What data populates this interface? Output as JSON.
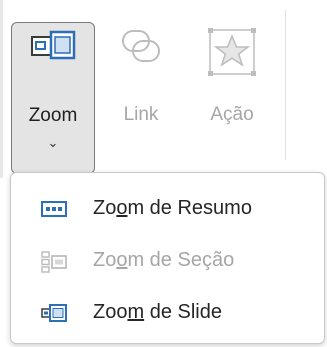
{
  "ribbon": {
    "zoom": {
      "label": "Zoom",
      "chevron": "⌄",
      "icon": "zoom-slides-icon"
    },
    "link": {
      "label": "Link",
      "icon": "link-icon"
    },
    "acao": {
      "label": "Ação",
      "icon": "action-star-icon"
    }
  },
  "menu": {
    "items": [
      {
        "pre": "Zo",
        "underline": "o",
        "post": "m de Resumo",
        "enabled": true,
        "icon": "summary-zoom-icon"
      },
      {
        "pre": "Zo",
        "underline": "o",
        "post": "m de Seção",
        "enabled": false,
        "icon": "section-zoom-icon"
      },
      {
        "pre": "Zoo",
        "underline": "m",
        "post": " de Slide",
        "enabled": true,
        "icon": "slide-zoom-icon"
      }
    ]
  },
  "colors": {
    "accent": "#2b6fb6",
    "disabled": "#a6a6a6",
    "button_pressed_bg": "#e4e4e4"
  }
}
